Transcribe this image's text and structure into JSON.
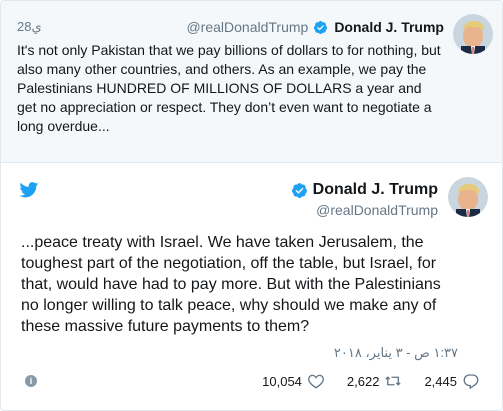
{
  "parent_tweet": {
    "time": "28ي",
    "handle": "@realDonaldTrump",
    "name": "Donald J. Trump",
    "text": "It's not only Pakistan that we pay billions of dollars to for nothing, but also many other countries, and others. As an example, we pay the Palestinians HUNDRED OF MILLIONS OF DOLLARS a year and get no appreciation or respect. They don’t even want to negotiate a long overdue..."
  },
  "main_tweet": {
    "name": "Donald J. Trump",
    "handle": "@realDonaldTrump",
    "text": "...peace treaty with Israel. We have taken Jerusalem, the toughest part of the negotiation, off the table, but Israel, for that, would have had to pay more. But with the Palestinians no longer willing to talk peace, why should we make any of these massive future payments to them?",
    "timestamp": "١:٣٧ ص - ٣ يناير، ٢٠١٨"
  },
  "footer": {
    "info_icon": "i",
    "likes": "10,054",
    "retweets": "2,622",
    "replies": "2,445"
  },
  "colors": {
    "twitter_blue": "#1da1f2",
    "secondary_text": "#657786",
    "parent_bg": "#f5f8fa",
    "border": "#e1e8ed"
  }
}
